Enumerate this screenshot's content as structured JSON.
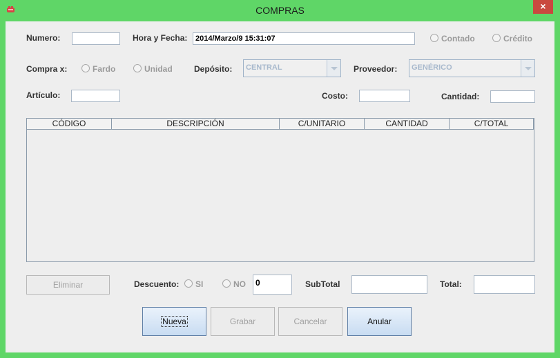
{
  "window": {
    "title": "COMPRAS",
    "close_symbol": "×"
  },
  "form": {
    "numero_label": "Numero:",
    "numero_value": "",
    "hora_fecha_label": "Hora y Fecha:",
    "hora_fecha_value": "2014/Marzo/9 15:31:07",
    "contado_label": "Contado",
    "credito_label": "Crédito",
    "compra_x_label": "Compra x:",
    "fardo_label": "Fardo",
    "unidad_label": "Unidad",
    "deposito_label": "Depósito:",
    "deposito_value": "CENTRAL",
    "proveedor_label": "Proveedor:",
    "proveedor_value": "GENÉRICO",
    "articulo_label": "Artículo:",
    "articulo_value": "",
    "costo_label": "Costo:",
    "costo_value": "",
    "cantidad_label": "Cantidad:",
    "cantidad_value": ""
  },
  "table": {
    "columns": [
      "CÓDIGO",
      "DESCRIPCIÓN",
      "C/UNITARIO",
      "CANTIDAD",
      "C/TOTAL"
    ],
    "rows": []
  },
  "footer": {
    "eliminar_label": "Eliminar",
    "descuento_label": "Descuento:",
    "si_label": "SI",
    "no_label": "NO",
    "descuento_value": "0",
    "subtotal_label": "SubTotal",
    "subtotal_value": "",
    "total_label": "Total:",
    "total_value": ""
  },
  "actions": {
    "nueva_label": "Nueva",
    "grabar_label": "Grabar",
    "cancelar_label": "Cancelar",
    "anular_label": "Anular"
  },
  "colors": {
    "window_frame": "#5fd667",
    "client_bg": "#eeeeee",
    "close_button": "#c9493f"
  }
}
